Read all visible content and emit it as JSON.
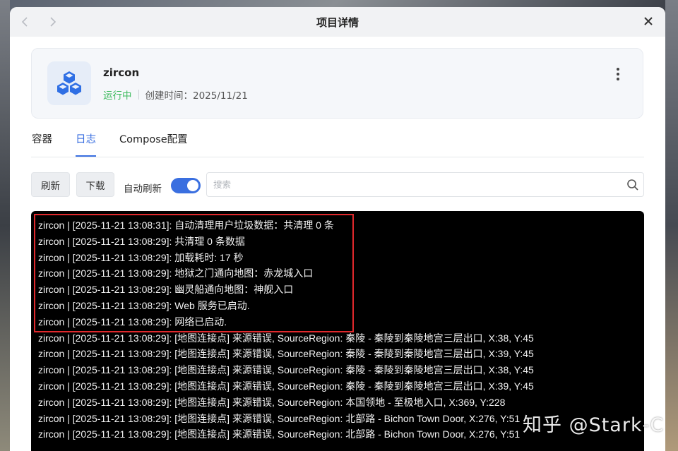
{
  "window": {
    "title": "项目详情"
  },
  "project": {
    "name": "zircon",
    "status": "运行中",
    "created": "创建时间：2025/11/21"
  },
  "tabs": [
    {
      "label": "容器"
    },
    {
      "label": "日志"
    },
    {
      "label": "Compose配置"
    }
  ],
  "toolbar": {
    "refresh_label": "刷新",
    "download_label": "下载",
    "auto_refresh_label": "自动刷新",
    "auto_refresh_on": true,
    "search_placeholder": "搜索"
  },
  "logs": [
    "zircon  | [2025-11-21 13:08:31]: 自动清理用户垃圾数据：共清理 0 条",
    "zircon  | [2025-11-21 13:08:29]: 共清理 0 条数据",
    "zircon  | [2025-11-21 13:08:29]: 加载耗时: 17 秒",
    "zircon  | [2025-11-21 13:08:29]: 地狱之门通向地图：赤龙城入口",
    "zircon  | [2025-11-21 13:08:29]: 幽灵船通向地图：神舰入口",
    "zircon  | [2025-11-21 13:08:29]: Web 服务已启动.",
    "zircon  | [2025-11-21 13:08:29]: 网络已启动.",
    "zircon  | [2025-11-21 13:08:29]: [地图连接点] 来源错误, SourceRegion: 秦陵 - 秦陵到秦陵地宫三层出口, X:38, Y:45",
    "zircon  | [2025-11-21 13:08:29]: [地图连接点] 来源错误, SourceRegion: 秦陵 - 秦陵到秦陵地宫三层出口, X:39, Y:45",
    "zircon  | [2025-11-21 13:08:29]: [地图连接点] 来源错误, SourceRegion: 秦陵 - 秦陵到秦陵地宫三层出口, X:38, Y:45",
    "zircon  | [2025-11-21 13:08:29]: [地图连接点] 来源错误, SourceRegion: 秦陵 - 秦陵到秦陵地宫三层出口, X:39, Y:45",
    "zircon  | [2025-11-21 13:08:29]: [地图连接点] 来源错误, SourceRegion: 本国领地 - 至极地入口, X:369, Y:228",
    "zircon  | [2025-11-21 13:08:29]: [地图连接点] 来源错误, SourceRegion: 北部路 - Bichon Town Door, X:276, Y:51",
    "zircon  | [2025-11-21 13:08:29]: [地图连接点] 来源错误, SourceRegion: 北部路 - Bichon Town Door, X:276, Y:51"
  ],
  "watermark": "知乎 @Stark-C",
  "colors": {
    "accent": "#3a6fe0",
    "running": "#3cba5c",
    "highlight": "#e0282c"
  }
}
